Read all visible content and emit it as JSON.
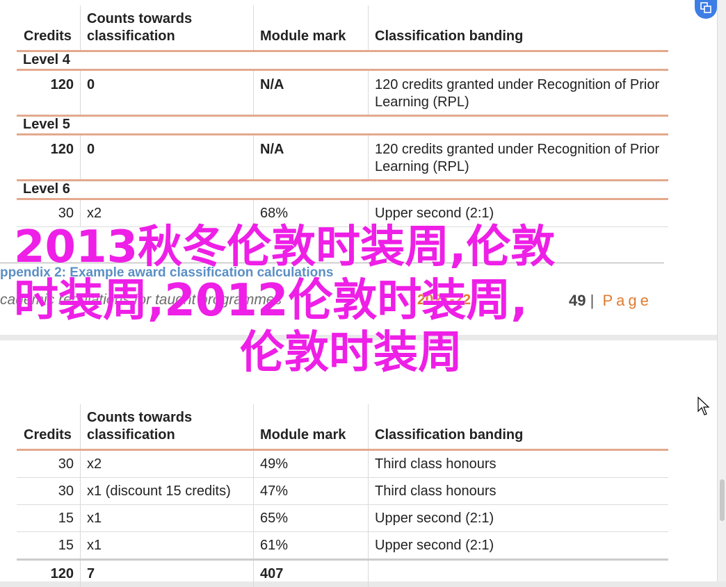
{
  "table_top": {
    "headers": [
      "Credits",
      "Counts towards classification",
      "Module mark",
      "Classification banding"
    ],
    "sections": [
      {
        "level": "Level 4",
        "row": {
          "credits": "120",
          "counts": "0",
          "mark": "N/A",
          "banding": "120 credits granted under Recognition of Prior Learning (RPL)"
        }
      },
      {
        "level": "Level 5",
        "row": {
          "credits": "120",
          "counts": "0",
          "mark": "N/A",
          "banding": "120 credits granted under Recognition of Prior Learning (RPL)"
        }
      },
      {
        "level": "Level 6",
        "row": {
          "credits": "30",
          "counts": "x2",
          "mark": "68%",
          "banding": "Upper second (2:1)"
        }
      }
    ]
  },
  "footer": {
    "appendix": "ppendix 2: Example award classification calculations",
    "regulations": "cademic regulations for taught programmes",
    "year": "2021-22",
    "page_number": "49",
    "separator": "|",
    "page_word": "Page"
  },
  "table_bottom": {
    "headers": [
      "Credits",
      "Counts towards classification",
      "Module mark",
      "Classification banding"
    ],
    "rows": [
      {
        "credits": "30",
        "counts": "x2",
        "mark": "49%",
        "banding": "Third class honours"
      },
      {
        "credits": "30",
        "counts": "x1 (discount 15 credits)",
        "mark": "47%",
        "banding": "Third class honours"
      },
      {
        "credits": "15",
        "counts": "x1",
        "mark": "65%",
        "banding": "Upper second (2:1)"
      },
      {
        "credits": "15",
        "counts": "x1",
        "mark": "61%",
        "banding": "Upper second (2:1)"
      }
    ],
    "total": {
      "credits": "120",
      "counts": "7",
      "mark": "407",
      "banding": ""
    }
  },
  "overlay": {
    "line1": "2013秋冬伦敦时装周,伦敦",
    "line2": "时装周,2012伦敦时装周,",
    "line3": "伦敦时装周"
  },
  "colors": {
    "overlay": "#ee1fe6",
    "rule": "#e3a98d",
    "footer_blue": "#5b8fc4",
    "accent_orange": "#e07b2f"
  },
  "icons": {
    "corner": "translate-icon",
    "cursor": "mouse-pointer-icon"
  }
}
